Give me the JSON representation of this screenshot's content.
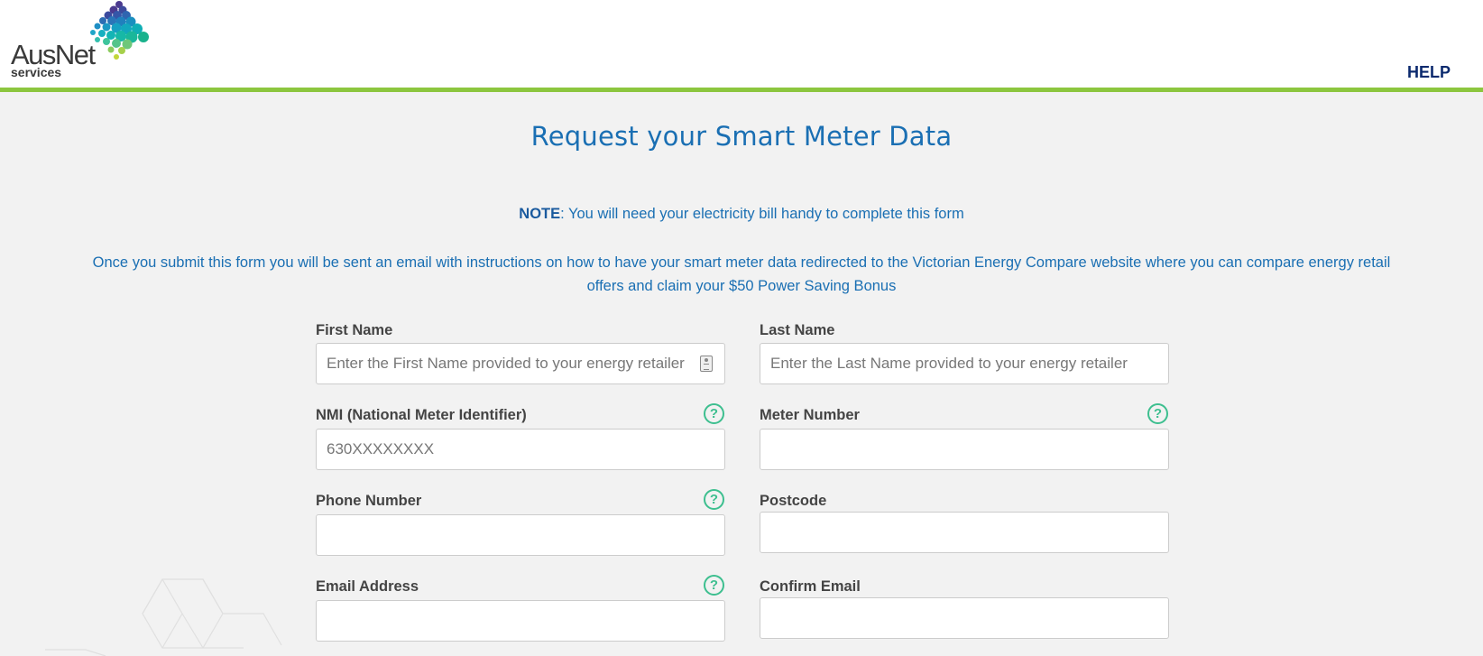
{
  "brand": {
    "logo_word": "AusNet",
    "logo_sub": "services",
    "accent_color": "#8cc63f"
  },
  "nav": {
    "help_label": "HELP"
  },
  "page": {
    "title": "Request your Smart Meter Data",
    "note_label": "NOTE",
    "note_text": ": You will need your electricity bill handy to complete this form",
    "info_text": "Once you submit this form you will be sent an email with instructions on how to have your smart meter data redirected to the Victorian Energy Compare website where you can compare energy retail offers and claim your $50 Power Saving Bonus"
  },
  "form": {
    "first_name": {
      "label": "First Name",
      "placeholder": "Enter the First Name provided to your energy retailer",
      "value": ""
    },
    "last_name": {
      "label": "Last Name",
      "placeholder": "Enter the Last Name provided to your energy retailer",
      "value": ""
    },
    "nmi": {
      "label": "NMI (National Meter Identifier)",
      "placeholder": "630XXXXXXXX",
      "value": ""
    },
    "meter_number": {
      "label": "Meter Number",
      "placeholder": "",
      "value": ""
    },
    "phone": {
      "label": "Phone Number",
      "placeholder": "",
      "value": ""
    },
    "postcode": {
      "label": "Postcode",
      "placeholder": "",
      "value": ""
    },
    "email": {
      "label": "Email Address",
      "placeholder": "",
      "value": ""
    },
    "confirm_email": {
      "label": "Confirm Email",
      "placeholder": "",
      "value": ""
    },
    "help_glyph": "?"
  },
  "icons": [
    "ausnet-logo",
    "help-circle-icon",
    "contact-card-icon",
    "hexagon-pattern"
  ]
}
